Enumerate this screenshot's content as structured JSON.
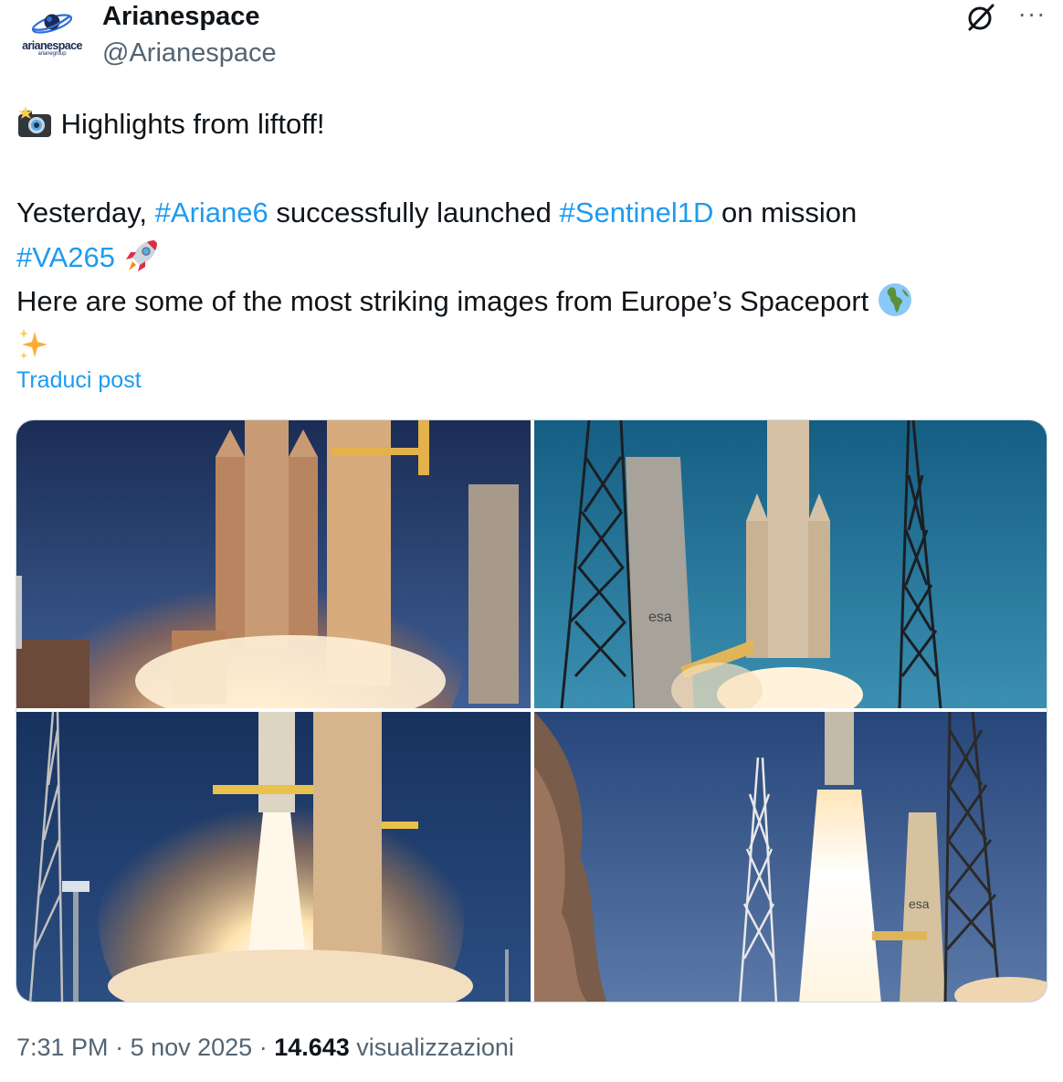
{
  "author": {
    "name": "Arianespace",
    "handle": "@Arianespace",
    "avatar_brand": "arianespace",
    "avatar_subbrand": "arianegroup"
  },
  "post": {
    "line1": "Highlights from liftoff!",
    "line2_pre": "Yesterday, ",
    "hashtag1": "#Ariane6",
    "line2_mid": " successfully launched ",
    "hashtag2": "#Sentinel1D",
    "line2_post": " on mission",
    "hashtag3": "#VA265",
    "line4": "Here are some of the most striking images from Europe’s Spaceport",
    "emojis": [
      "camera-flash-emoji",
      "rocket-emoji",
      "globe-emoji",
      "sparkles-emoji"
    ]
  },
  "translate_label": "Traduci post",
  "media": {
    "photos": [
      "liftoff-photo-1",
      "liftoff-photo-2",
      "liftoff-photo-3",
      "liftoff-photo-4"
    ],
    "label_esa": "esa"
  },
  "meta": {
    "time": "7:31 PM",
    "sep1": " · ",
    "date": "5 nov 2025",
    "sep2": " · ",
    "views_count": "14.643",
    "views_label": " visualizzazioni"
  },
  "colors": {
    "link": "#1d9bf0",
    "text": "#0f1419",
    "secondary": "#536471"
  }
}
